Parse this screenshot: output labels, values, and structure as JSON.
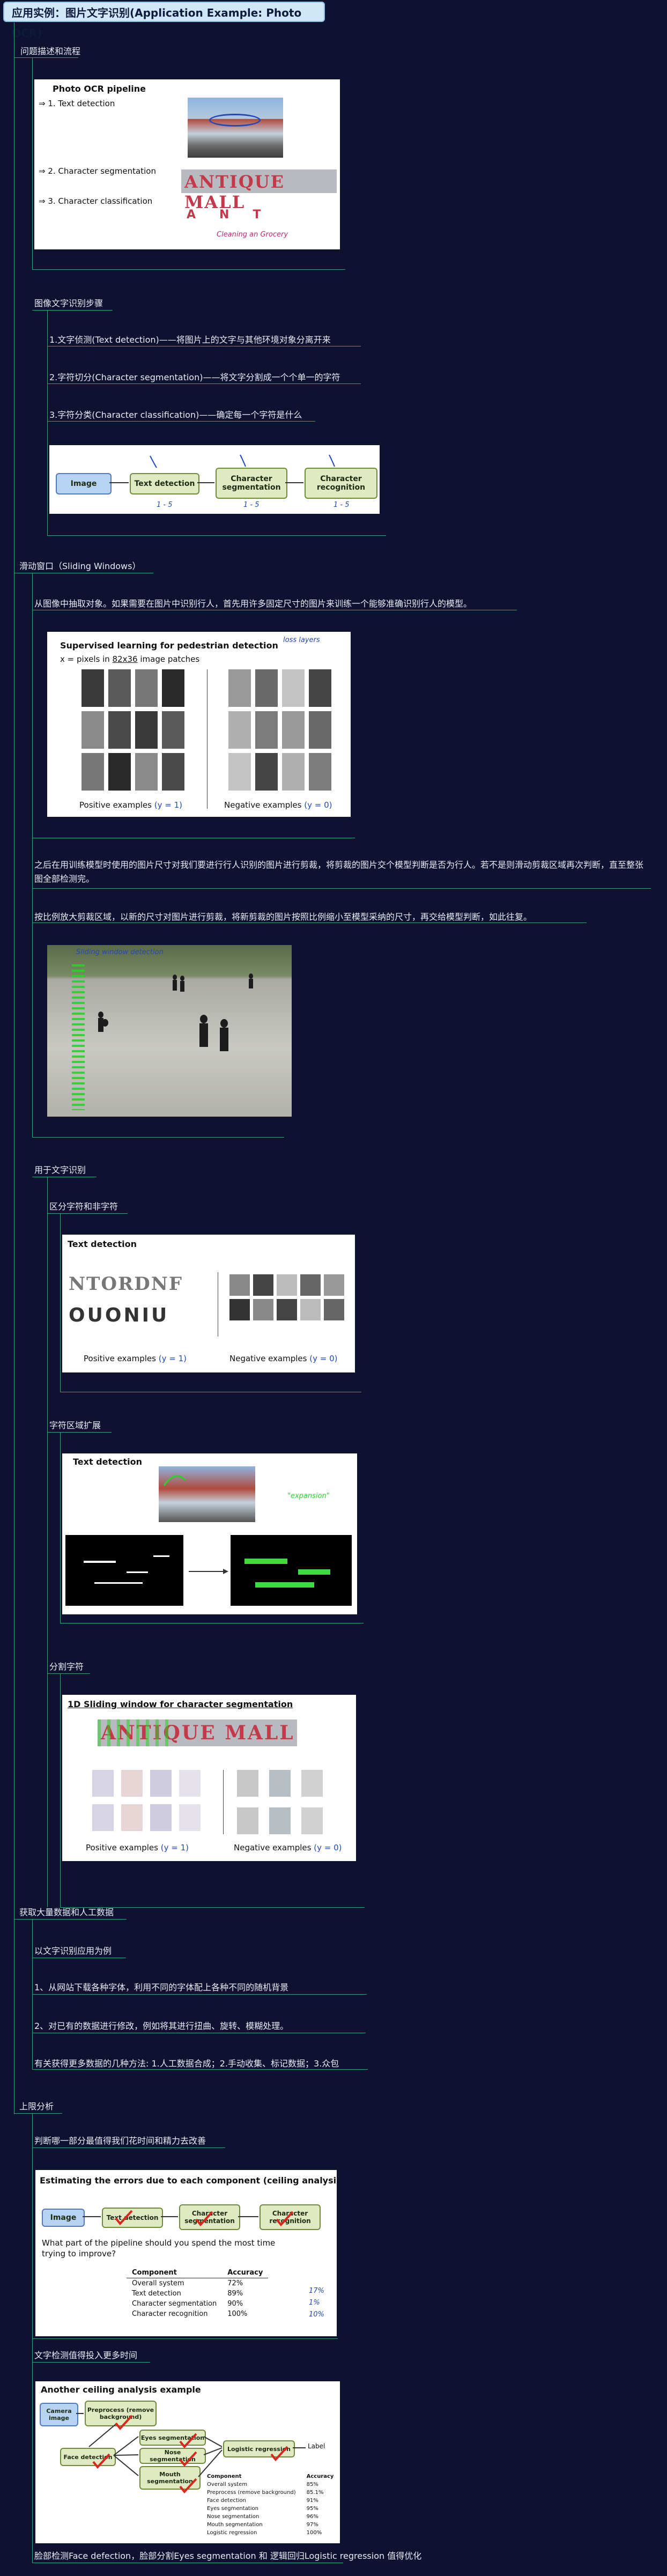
{
  "title": "应用实例：图片文字识别(Application Example: Photo OCR)",
  "sections": {
    "problem": "问题描述和流程",
    "pipeline_steps": "图像文字识别步骤",
    "step1": "1.文字侦测(Text detection)——将图片上的文字与其他环境对象分离开来",
    "step2": "2.字符切分(Character segmentation)——将文字分割成一个个单一的字符",
    "step3": "3.字符分类(Character classification)——确定每一个字符是什么",
    "sliding": "滑动窗口（Sliding Windows）",
    "sliding_intro": "从图像中抽取对象。如果需要在图片中识别行人，首先用许多固定尺寸的图片来训练一个能够准确识别行人的模型。",
    "sliding_p2": "之后在用训练模型时使用的图片尺寸对我们要进行行人识别的图片进行剪裁，将剪裁的图片交个模型判断是否为行人。若不是则滑动剪裁区域再次判断，直至整张图全部检测完。",
    "sliding_p3": "按比例放大剪裁区域，以新的尺寸对图片进行剪裁，将新剪裁的图片按照比例缩小至模型采纳的尺寸，再交给模型判断，如此往复。",
    "text_rec": "用于文字识别",
    "distinguish": "区分字符和非字符",
    "expand": "字符区域扩展",
    "split": "分割字符",
    "data": "获取大量数据和人工数据",
    "data_example": "以文字识别应用为例",
    "data1": "1、从网站下载各种字体，利用不同的字体配上各种不同的随机背景",
    "data2": "2、对已有的数据进行修改，例如将其进行扭曲、旋转、模糊处理。",
    "data3": "有关获得更多数据的几种方法: 1.人工数据合成；2.手动收集、标记数据；3.众包",
    "ceiling": "上限分析",
    "ceiling_q": "判断哪一部分最值得我们花时间和精力去改善",
    "text_det_more": "文字检测值得投入更多时间",
    "face": "脸部检测Face defection，脸部分割Eyes segmentation 和 逻辑回归Logistic regression 值得优化"
  },
  "ocr_card": {
    "title": "Photo OCR pipeline",
    "item1": "⇒ 1. Text detection",
    "item2": "⇒ 2. Character segmentation",
    "item3": "⇒ 3. Character classification",
    "sign_text": "ANTIQUE MALL",
    "letters": [
      "A",
      "N",
      "T"
    ],
    "handwritten": "Cleaning an Grocery"
  },
  "flow": {
    "boxes": [
      "Image",
      "Text detection",
      "Character segmentation",
      "Character recognition"
    ],
    "notes": [
      "1 - 5",
      "1 - 5",
      "1 - 5"
    ]
  },
  "ped_card": {
    "title": "Supervised learning for pedestrian detection",
    "subtitle_pre": "x = pixels in ",
    "subtitle_dims": "82x36",
    "subtitle_post": " image patches",
    "pos": "Positive examples",
    "pos_y": "(y = 1)",
    "neg": "Negative examples",
    "neg_y": "(y = 0)",
    "note": "loss layers"
  },
  "street_card": {
    "label": "Sliding window detection"
  },
  "textdet_card": {
    "title": "Text detection",
    "pos": "Positive examples",
    "pos_y": "(y = 1)",
    "neg": "Negative examples",
    "neg_y": "(y = 0)",
    "letters_top": "NTORDNF",
    "letters_bottom": "OUONIU"
  },
  "expand_card": {
    "title": "Text detection",
    "note": "\"expansion\""
  },
  "seg_card": {
    "title": "1D Sliding window for character segmentation",
    "sign_text": "ANTIQUE MALL",
    "pos": "Positive examples",
    "pos_y": "(y = 1)",
    "neg": "Negative examples",
    "neg_y": "(y = 0)"
  },
  "ceiling_card": {
    "title": "Estimating the errors due to each component (ceiling analysis)",
    "boxes": [
      "Image",
      "Text detection",
      "Character segmentation",
      "Character recognition"
    ],
    "question": "What part of the pipeline should you spend the most time trying to improve?",
    "col1": "Component",
    "col2": "Accuracy",
    "rows": [
      {
        "c": "Overall system",
        "a": "72%"
      },
      {
        "c": "Text detection",
        "a": "89%"
      },
      {
        "c": "Character segmentation",
        "a": "90%"
      },
      {
        "c": "Character recognition",
        "a": "100%"
      }
    ],
    "notes": [
      "17%",
      "1%",
      "10%"
    ]
  },
  "face_card": {
    "title": "Another ceiling analysis example",
    "boxes": {
      "camera": "Camera image",
      "preprocess": "Preprocess (remove background)",
      "face": "Face detection",
      "eyes": "Eyes segmentation",
      "nose": "Nose segmentation",
      "mouth": "Mouth segmentation",
      "logistic": "Logistic regression",
      "label": "Label"
    },
    "table_rows": [
      {
        "c": "Overall system",
        "a": "85%"
      },
      {
        "c": "Preprocess (remove background)",
        "a": "85.1%"
      },
      {
        "c": "Face detection",
        "a": "91%"
      },
      {
        "c": "Eyes segmentation",
        "a": "95%"
      },
      {
        "c": "Nose segmentation",
        "a": "96%"
      },
      {
        "c": "Mouth segmentation",
        "a": "97%"
      },
      {
        "c": "Logistic regression",
        "a": "100%"
      }
    ],
    "col1": "Component",
    "col2": "Accuracy"
  },
  "colors": {
    "background": "#0e1230",
    "connector": "#39a36f",
    "title_bg": "#cfe7f7"
  }
}
